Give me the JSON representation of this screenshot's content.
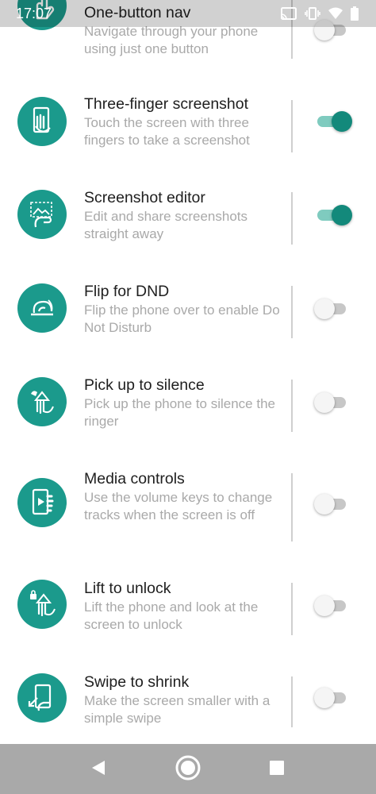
{
  "status_bar": {
    "time": "17:07",
    "icons": [
      "cast-icon",
      "vibrate-icon",
      "wifi-icon",
      "battery-icon"
    ]
  },
  "colors": {
    "accent": "#1b9a8c",
    "toggle_on": "#13897b",
    "title_text": "#202020",
    "subtitle_text": "#a9a9a9"
  },
  "settings": [
    {
      "title": "One-button nav",
      "subtitle": "Navigate through your phone using just one button",
      "icon": "one-button-nav-icon",
      "enabled": false
    },
    {
      "title": "Three-finger screenshot",
      "subtitle": "Touch the screen with three fingers to take a screenshot",
      "icon": "three-finger-screenshot-icon",
      "enabled": true
    },
    {
      "title": "Screenshot editor",
      "subtitle": "Edit and share screenshots straight away",
      "icon": "screenshot-editor-icon",
      "enabled": true
    },
    {
      "title": "Flip for DND",
      "subtitle": "Flip the phone over to enable Do Not Disturb",
      "icon": "flip-for-dnd-icon",
      "enabled": false
    },
    {
      "title": "Pick up to silence",
      "subtitle": "Pick up the phone to silence the ringer",
      "icon": "pick-up-to-silence-icon",
      "enabled": false
    },
    {
      "title": "Media controls",
      "subtitle": "Use the volume keys to change tracks when the screen is off",
      "icon": "media-controls-icon",
      "enabled": false
    },
    {
      "title": "Lift to unlock",
      "subtitle": "Lift the phone and look at the screen to unlock",
      "icon": "lift-to-unlock-icon",
      "enabled": false
    },
    {
      "title": "Swipe to shrink",
      "subtitle": "Make the screen smaller with a simple swipe",
      "icon": "swipe-to-shrink-icon",
      "enabled": false
    }
  ],
  "nav_bar": {
    "buttons": [
      "back-icon",
      "home-icon",
      "recents-icon"
    ]
  }
}
